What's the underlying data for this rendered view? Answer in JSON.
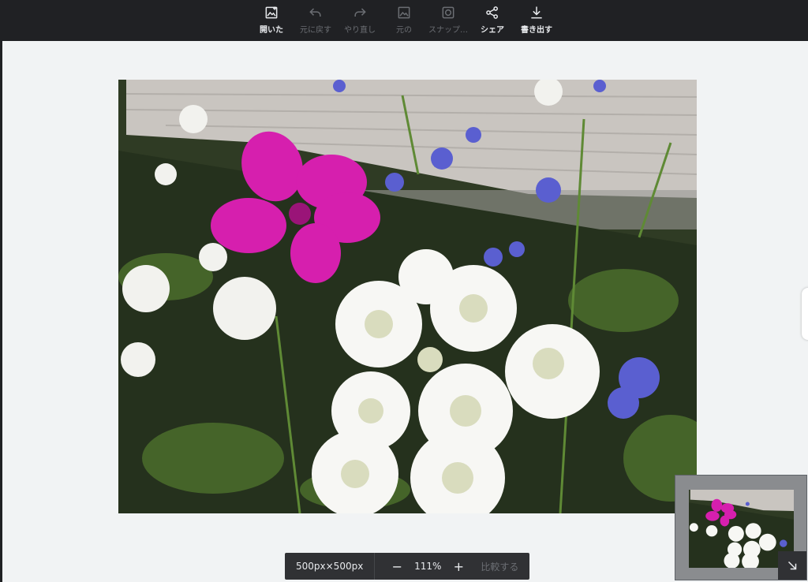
{
  "toolbar": {
    "items": [
      {
        "label": "開いた",
        "icon": "open-image-icon",
        "enabled": true
      },
      {
        "label": "元に戻す",
        "icon": "undo-icon",
        "enabled": false
      },
      {
        "label": "やり直し",
        "icon": "redo-icon",
        "enabled": false
      },
      {
        "label": "元の",
        "icon": "original-image-icon",
        "enabled": false
      },
      {
        "label": "スナップ…",
        "icon": "snapshot-icon",
        "enabled": false
      },
      {
        "label": "シェア",
        "icon": "share-icon",
        "enabled": true
      },
      {
        "label": "書き出す",
        "icon": "download-icon",
        "enabled": true
      }
    ]
  },
  "zoom_bar": {
    "size": "500px×500px",
    "minus": "−",
    "zoom": "111%",
    "plus": "+",
    "compare": "比較する"
  },
  "colors": {
    "toolbar_bg": "#202124",
    "canvas_bg": "#f1f3f4",
    "enabled_text": "#e8eaed",
    "disabled_text": "#6b6e73",
    "flower_magenta": "#d61fae",
    "flower_blue": "#5a5fd0"
  }
}
